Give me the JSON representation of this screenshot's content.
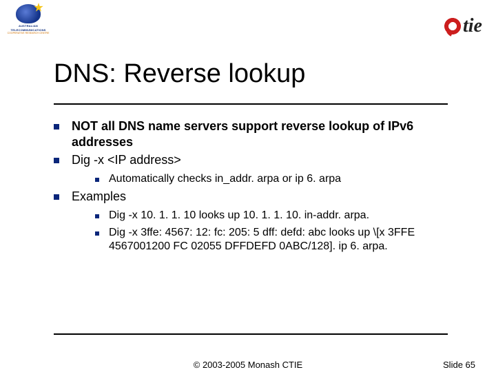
{
  "logos": {
    "left_line1": "AUSTRALIAN",
    "left_line2": "TELECOMMUNICATIONS",
    "left_line3": "COOPERATIVE RESEARCH CENTRE",
    "right_text": "tie"
  },
  "title": "DNS: Reverse lookup",
  "bullets": [
    {
      "text": "NOT all DNS name servers support reverse lookup of IPv6 addresses",
      "bold": true
    },
    {
      "text": "Dig -x <IP address>"
    },
    {
      "sub": [
        {
          "text": "Automatically checks in_addr. arpa or ip 6. arpa"
        }
      ]
    },
    {
      "text": "Examples"
    },
    {
      "sub": [
        {
          "text": "Dig -x 10. 1. 1. 10  looks up 10. 1. 1. 10. in-addr. arpa."
        },
        {
          "text": "Dig -x 3ffe: 4567: 12: fc: 205: 5 dff: defd: abc looks up \\[x 3FFE 4567001200 FC 02055 DFFDEFD 0ABC/128]. ip 6. arpa."
        }
      ]
    }
  ],
  "footer": {
    "copyright": "© 2003-2005 Monash CTIE",
    "page": "Slide 65"
  }
}
